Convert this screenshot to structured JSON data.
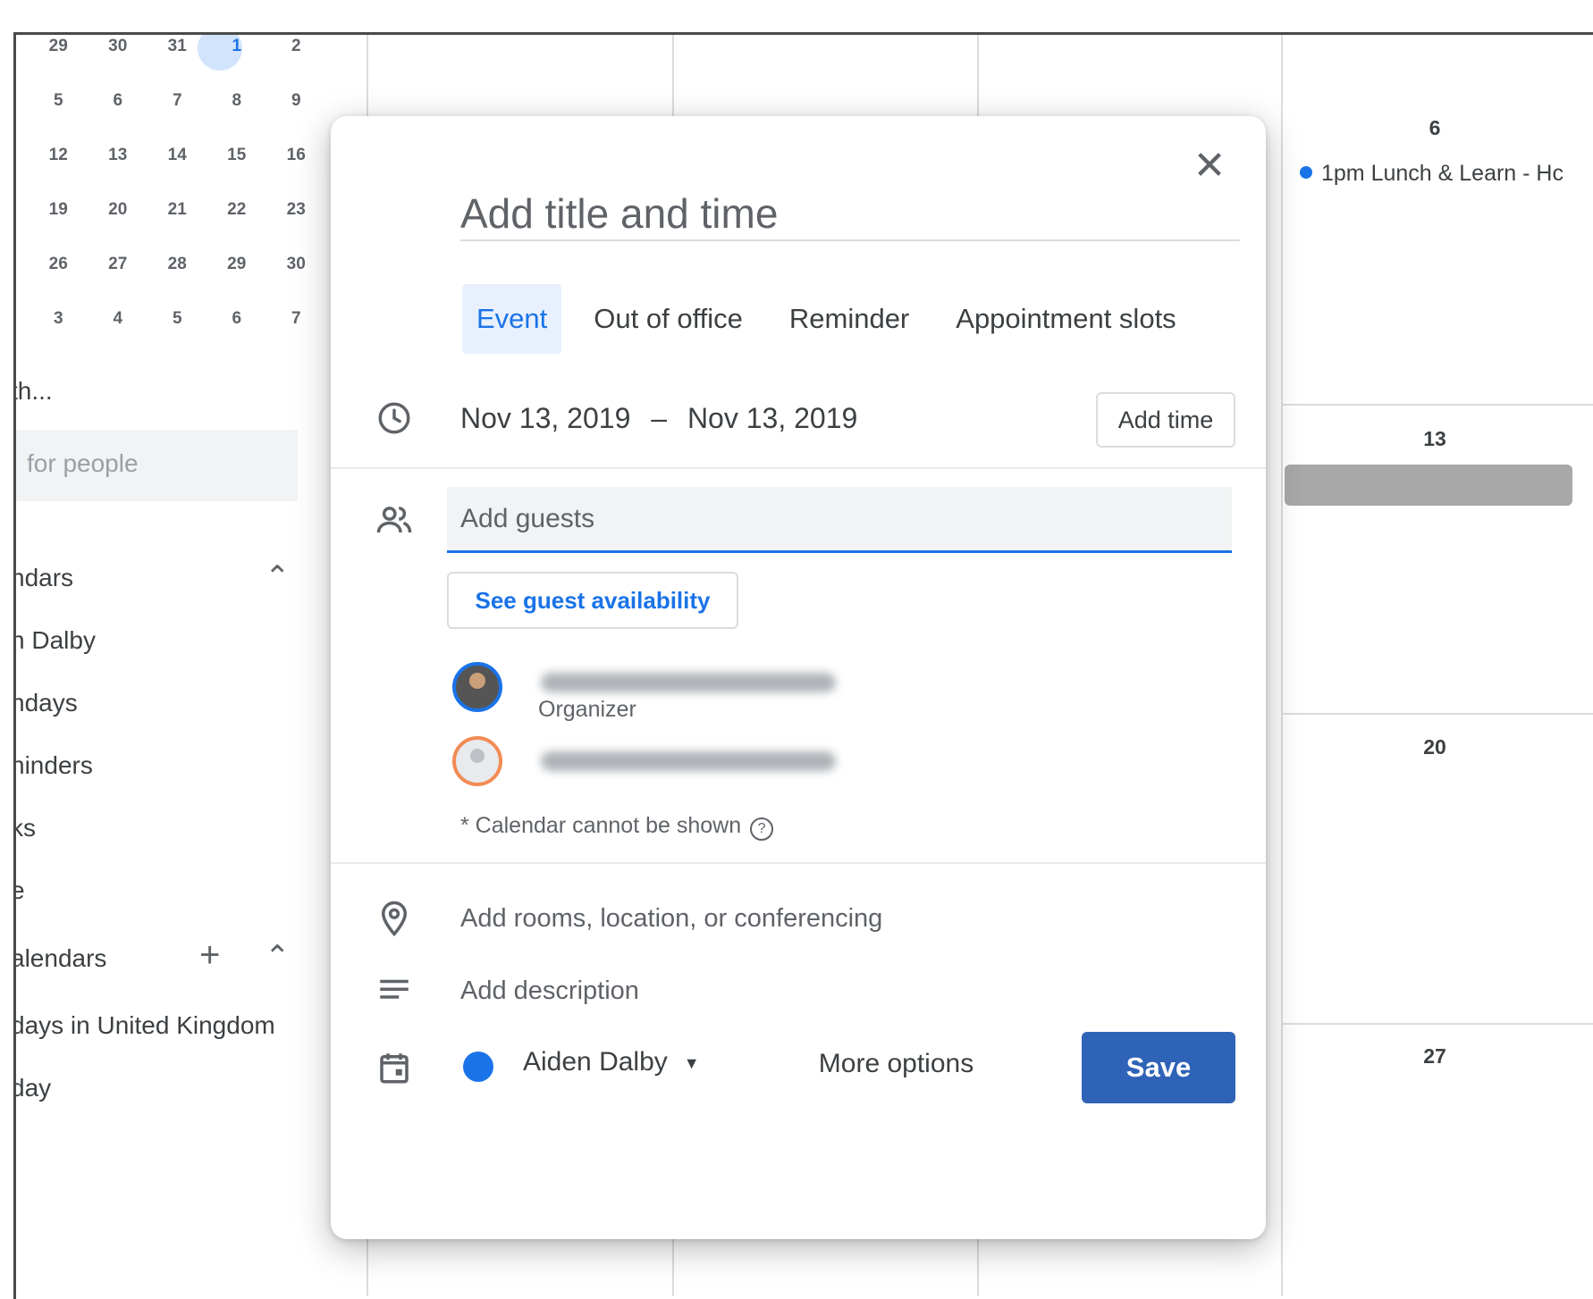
{
  "mini_calendar": {
    "rows": [
      [
        "29",
        "30",
        "31",
        "1",
        "2"
      ],
      [
        "5",
        "6",
        "7",
        "8",
        "9"
      ],
      [
        "12",
        "13",
        "14",
        "15",
        "16"
      ],
      [
        "19",
        "20",
        "21",
        "22",
        "23"
      ],
      [
        "26",
        "27",
        "28",
        "29",
        "30"
      ],
      [
        "3",
        "4",
        "5",
        "6",
        "7"
      ]
    ]
  },
  "sidebar": {
    "meet_with": "th...",
    "search_people_placeholder": "for people",
    "my_calendars_header": "ndars",
    "my_calendars": [
      "n Dalby",
      "hdays",
      "ninders",
      "ks",
      "e"
    ],
    "other_calendars_header": "alendars",
    "other_calendars": [
      "days in United Kingdom",
      "day"
    ]
  },
  "grid": {
    "day_numbers": [
      "6",
      "13",
      "20",
      "27"
    ],
    "event": "1pm Lunch & Learn - Hc"
  },
  "dialog": {
    "title_placeholder": "Add title and time",
    "tabs": [
      "Event",
      "Out of office",
      "Reminder",
      "Appointment slots"
    ],
    "start_date": "Nov 13, 2019",
    "date_separator": "–",
    "end_date": "Nov 13, 2019",
    "add_time": "Add time",
    "guests_placeholder": "Add guests",
    "see_availability": "See guest availability",
    "organizer_label": "Organizer",
    "calendar_note": "* Calendar cannot be shown",
    "help_glyph": "?",
    "location_placeholder": "Add rooms, location, or conferencing",
    "description_placeholder": "Add description",
    "calendar_name": "Aiden Dalby",
    "more_options": "More options",
    "save": "Save"
  },
  "colors": {
    "accent": "#1a73e8",
    "save_button": "#2f63b7"
  }
}
